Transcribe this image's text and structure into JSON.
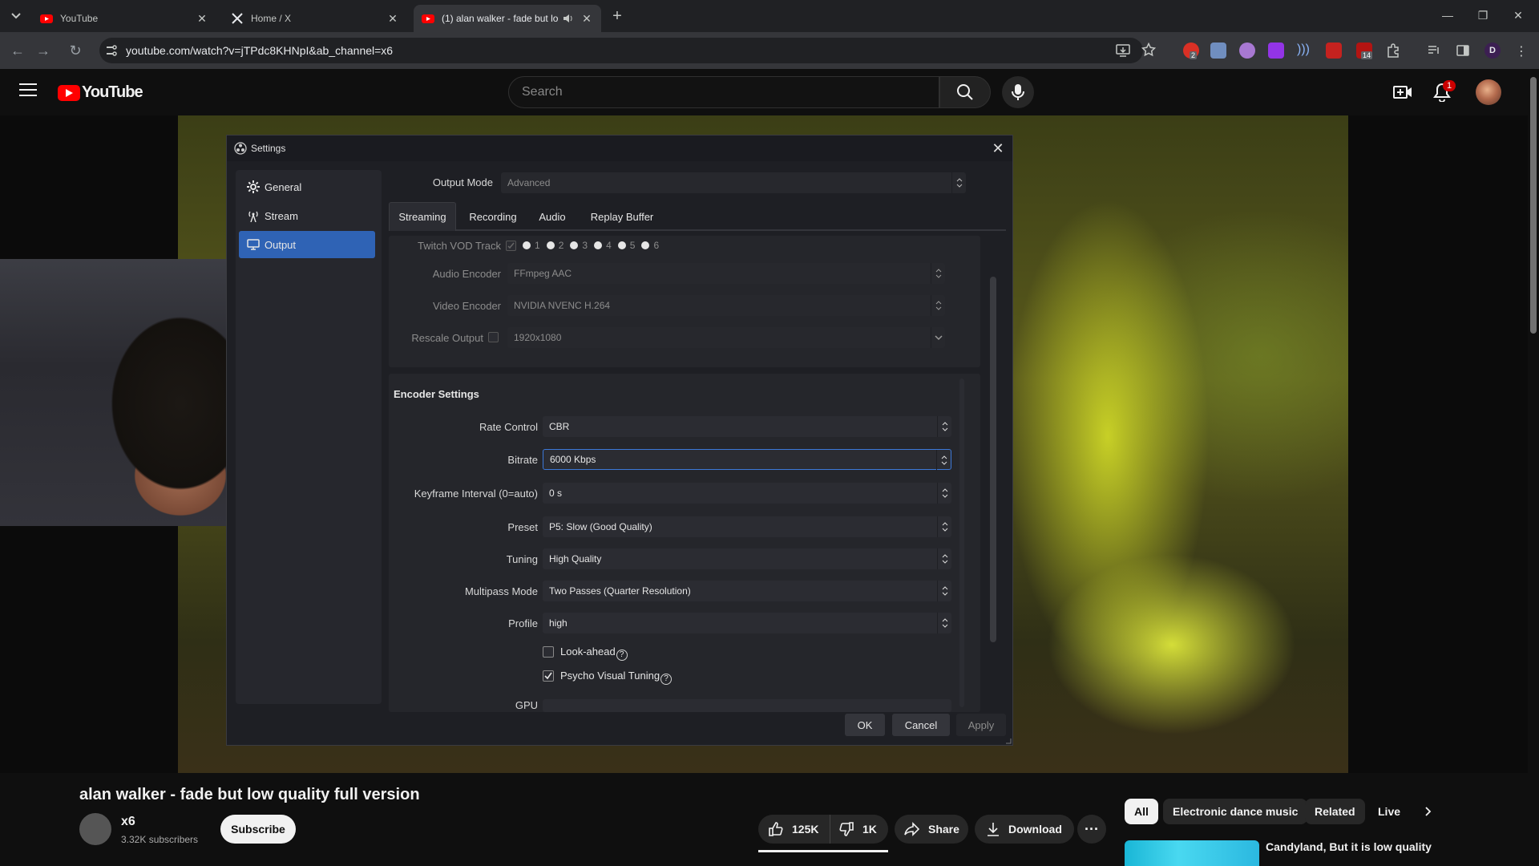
{
  "browser": {
    "tabs": [
      {
        "title": "YouTube",
        "favicon": "youtube-icon"
      },
      {
        "title": "Home / X",
        "favicon": "x-icon"
      },
      {
        "title": "(1) alan walker - fade but lo",
        "favicon": "youtube-icon",
        "audio": "speaker-icon",
        "active": true
      }
    ],
    "url": "youtube.com/watch?v=jTPdc8KHNpI&ab_channel=x6",
    "extension_badges": {
      "first": "2",
      "second": "14"
    },
    "profile_initial": "D"
  },
  "youtube": {
    "logo_text": "YouTube",
    "search_placeholder": "Search",
    "notification_count": "1",
    "video_title": "alan walker - fade but low quality full version",
    "channel": {
      "name": "x6",
      "subscribers": "3.32K subscribers"
    },
    "subscribe_label": "Subscribe",
    "likes": "125K",
    "dislikes": "1K",
    "share_label": "Share",
    "download_label": "Download",
    "chips": [
      "All",
      "Electronic dance music",
      "Related",
      "Live"
    ],
    "recommended_title": "Candyland, But it is low quality"
  },
  "settings": {
    "window_title": "Settings",
    "sidebar": [
      {
        "label": "General",
        "icon": "gear-icon"
      },
      {
        "label": "Stream",
        "icon": "antenna-icon"
      },
      {
        "label": "Output",
        "icon": "monitor-icon",
        "active": true
      }
    ],
    "output_mode_label": "Output Mode",
    "output_mode_value": "Advanced",
    "tabs": [
      "Streaming",
      "Recording",
      "Audio",
      "Replay Buffer"
    ],
    "twitch_vod_label": "Twitch VOD Track",
    "tracks": [
      "1",
      "2",
      "3",
      "4",
      "5",
      "6"
    ],
    "audio_encoder_label": "Audio Encoder",
    "audio_encoder_value": "FFmpeg AAC",
    "video_encoder_label": "Video Encoder",
    "video_encoder_value": "NVIDIA NVENC H.264",
    "rescale_label": "Rescale Output",
    "rescale_value": "1920x1080",
    "encoder_settings_title": "Encoder Settings",
    "rate_control_label": "Rate Control",
    "rate_control_value": "CBR",
    "bitrate_label": "Bitrate",
    "bitrate_value": "6000 Kbps",
    "keyframe_label": "Keyframe Interval (0=auto)",
    "keyframe_value": "0 s",
    "preset_label": "Preset",
    "preset_value": "P5: Slow (Good Quality)",
    "tuning_label": "Tuning",
    "tuning_value": "High Quality",
    "multipass_label": "Multipass Mode",
    "multipass_value": "Two Passes (Quarter Resolution)",
    "profile_label": "Profile",
    "profile_value": "high",
    "lookahead_label": "Look-ahead",
    "lookahead_checked": false,
    "psycho_label": "Psycho Visual Tuning",
    "psycho_checked": true,
    "gpu_label": "GPU",
    "ok_label": "OK",
    "cancel_label": "Cancel",
    "apply_label": "Apply"
  }
}
